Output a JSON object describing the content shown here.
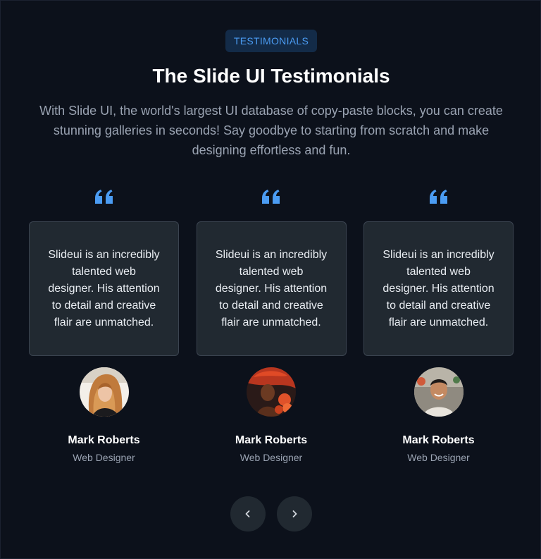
{
  "header": {
    "badge": "TESTIMONIALS",
    "title": "The Slide UI Testimonials",
    "subtitle": "With Slide UI, the world's largest UI database of copy-paste blocks, you can create stunning galleries in seconds! Say goodbye to starting from scratch and make designing effortless and fun."
  },
  "testimonials": [
    {
      "quote": "Slideui is an incredibly talented web designer. His attention to detail and creative flair are unmatched.",
      "name": "Mark Roberts",
      "role": "Web Designer"
    },
    {
      "quote": "Slideui is an incredibly talented web designer. His attention to detail and creative flair are unmatched.",
      "name": "Mark Roberts",
      "role": "Web Designer"
    },
    {
      "quote": "Slideui is an incredibly talented web designer. His attention to detail and creative flair are unmatched.",
      "name": "Mark Roberts",
      "role": "Web Designer"
    }
  ],
  "icons": {
    "quote": "quote-icon",
    "prev": "chevron-left-icon",
    "next": "chevron-right-icon"
  },
  "colors": {
    "background": "#0c111b",
    "accent": "#4b9cf3",
    "card": "#212931",
    "card_border": "#3b4450",
    "muted_text": "#9aa3b2"
  }
}
